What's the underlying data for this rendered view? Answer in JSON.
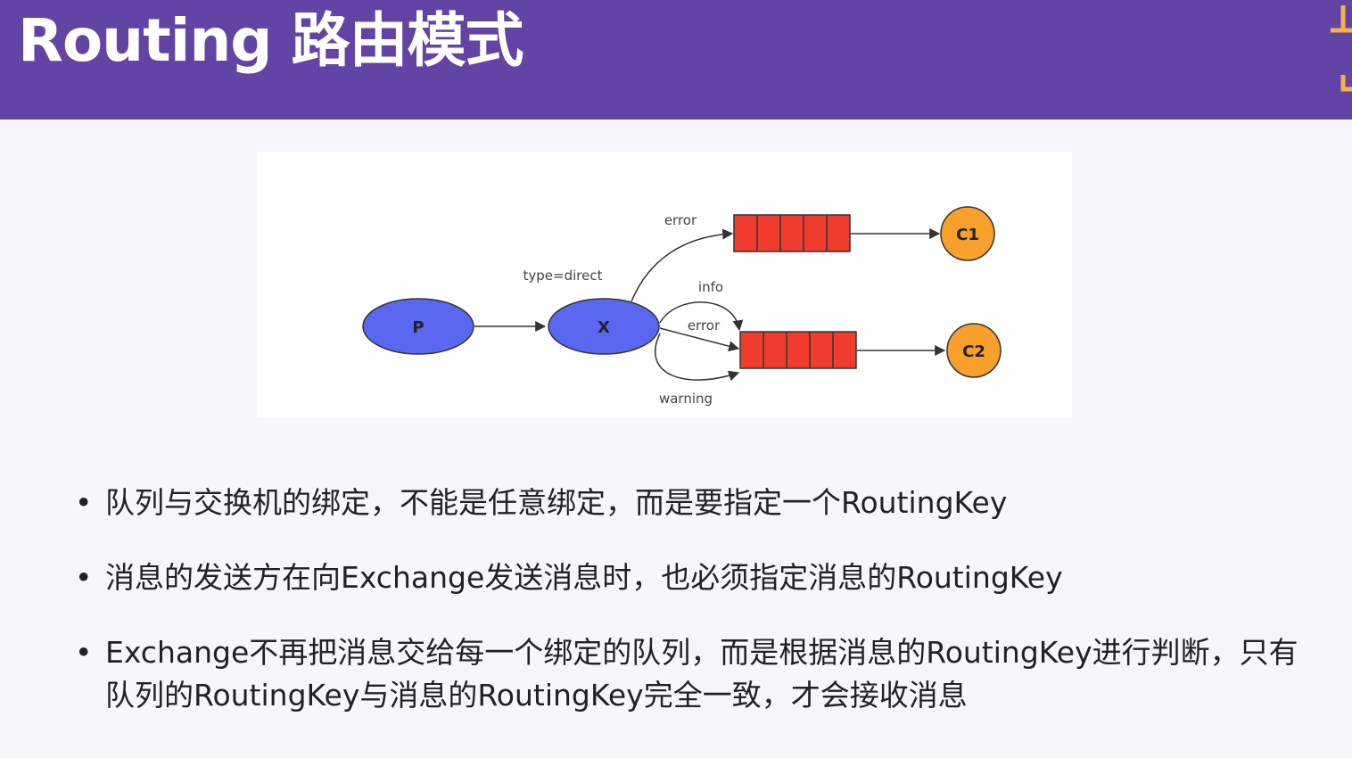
{
  "header": {
    "title": "Routing 路由模式",
    "background": "#6244a5"
  },
  "diagram": {
    "exchange_type_label": "type=direct",
    "producer_label": "P",
    "exchange_label": "X",
    "consumer1_label": "C1",
    "consumer2_label": "C2",
    "bindings": {
      "queue1": [
        "error"
      ],
      "queue2": [
        "info",
        "error",
        "warning"
      ]
    },
    "binding_labels": {
      "q1_error": "error",
      "q2_info": "info",
      "q2_error": "error",
      "q2_warning": "warning"
    },
    "colors": {
      "ellipse": "#5a67f0",
      "queue": "#f03c2c",
      "consumer": "#f7a02c"
    }
  },
  "bullets": [
    "队列与交换机的绑定，不能是任意绑定，而是要指定一个RoutingKey",
    "消息的发送方在向Exchange发送消息时，也必须指定消息的RoutingKey",
    "Exchange不再把消息交给每一个绑定的队列，而是根据消息的RoutingKey进行判断，只有队列的RoutingKey与消息的RoutingKey完全一致，才会接收消息"
  ]
}
